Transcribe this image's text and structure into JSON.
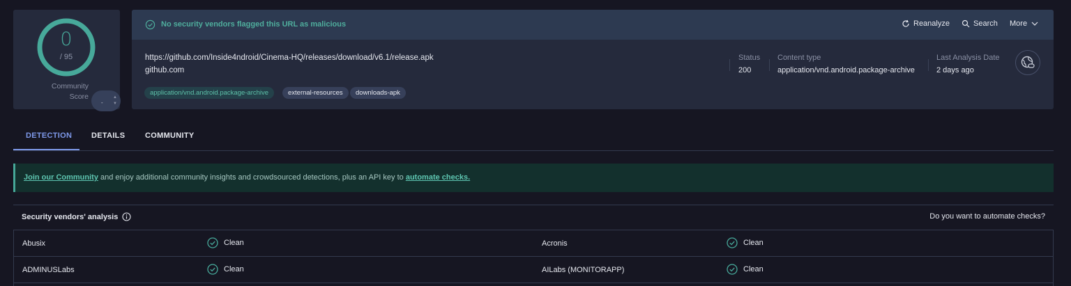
{
  "score": {
    "value": "0",
    "total": "/ 95",
    "community_label_1": "Community",
    "community_label_2": "Score",
    "toggle_value": "-"
  },
  "banner": {
    "message": "No security vendors flagged this URL as malicious"
  },
  "actions": {
    "reanalyze": "Reanalyze",
    "search": "Search",
    "more": "More"
  },
  "target": {
    "url": "https://github.com/Inside4ndroid/Cinema-HQ/releases/download/v6.1/release.apk",
    "domain": "github.com",
    "tags": [
      "application/vnd.android.package-archive",
      "external-resources",
      "downloads-apk"
    ]
  },
  "meta": {
    "status_label": "Status",
    "status_value": "200",
    "content_type_label": "Content type",
    "content_type_value": "application/vnd.android.package-archive",
    "last_analysis_label": "Last Analysis Date",
    "last_analysis_value": "2 days ago"
  },
  "tabs": [
    "DETECTION",
    "DETAILS",
    "COMMUNITY"
  ],
  "promo": {
    "link1": "Join our Community",
    "middle": " and enjoy additional community insights and crowdsourced detections, plus an API key to ",
    "link2": "automate checks."
  },
  "vendors": {
    "title": "Security vendors' analysis",
    "automate": "Do you want to automate checks?",
    "rows": [
      {
        "left_name": "Abusix",
        "left_result": "Clean",
        "right_name": "Acronis",
        "right_result": "Clean"
      },
      {
        "left_name": "ADMINUSLabs",
        "left_result": "Clean",
        "right_name": "AILabs (MONITORAPP)",
        "right_result": "Clean"
      }
    ]
  },
  "colors": {
    "accent": "#7e99ea",
    "clean": "#47a99a",
    "panel": "#252a3c",
    "background": "#161622"
  }
}
